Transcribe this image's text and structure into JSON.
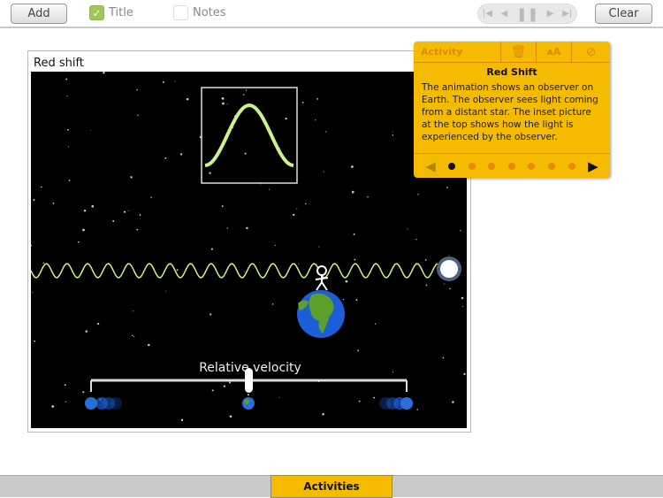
{
  "toolbar": {
    "add": "Add",
    "title_checkbox": "Title",
    "title_checked": true,
    "notes_checkbox": "Notes",
    "notes_checked": false,
    "clear": "Clear"
  },
  "frame": {
    "title": "Red shift"
  },
  "scene": {
    "slider_label": "Relative velocity",
    "slider_value": 0.5
  },
  "panel": {
    "header": "Activity",
    "title": "Red Shift",
    "text": "The animation shows an observer on Earth. The observer sees light coming from a distant star. The inset picture at the top shows how the light is experienced by the observer.",
    "page": 1,
    "pages": 7
  },
  "bottom": {
    "activities_tab": "Activities"
  },
  "colors": {
    "accent": "#f5bb00",
    "wave": "#ccf28a"
  }
}
